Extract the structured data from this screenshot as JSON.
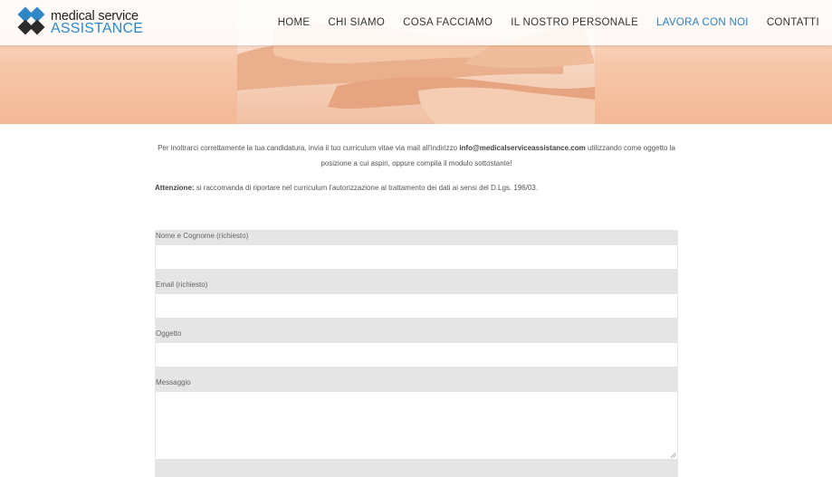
{
  "brand": {
    "line1": "medical service",
    "line2": "ASSISTANCE",
    "colors": {
      "blue": "#2e88c8",
      "dark": "#333333"
    }
  },
  "nav": {
    "items": [
      {
        "label": "HOME"
      },
      {
        "label": "CHI SIAMO"
      },
      {
        "label": "COSA FACCIAMO"
      },
      {
        "label": "IL NOSTRO PERSONALE"
      },
      {
        "label": "LAVORA CON NOI",
        "active": true
      },
      {
        "label": "CONTATTI"
      }
    ],
    "active_color": "#2e7fc0"
  },
  "content": {
    "intro_pre": "Per inoltrarci correttamente la tua candidatura, invia il tuo curriculum vitae via mail all'indirizzo ",
    "email": "info@medicalserviceassistance.com",
    "intro_post": " utilizzando come oggetto la posizione a cui aspiri, oppure compila il modulo sottostante!",
    "warning_label": "Attenzione:",
    "warning_text": " si raccomanda di riportare nel curriculum l'autorizzazione al trattamento dei dati ai sensi del D.Lgs. 196/03."
  },
  "form": {
    "name_label": "Nome e Cognome (richiesto)",
    "email_label": "Email (richiesto)",
    "subject_label": "Oggetto",
    "message_label": "Messaggio",
    "name_value": "",
    "email_value": "",
    "subject_value": "",
    "message_value": ""
  }
}
